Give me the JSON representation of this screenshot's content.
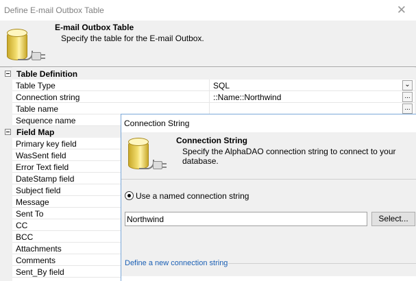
{
  "window": {
    "title": "Define E-mail Outbox Table",
    "close_glyph": "✕"
  },
  "header": {
    "title": "E-mail Outbox Table",
    "subtitle": "Specify the table for the E-mail  Outbox."
  },
  "property_grid": {
    "categories": [
      {
        "label": "Table Definition",
        "rows": [
          {
            "label": "Table Type",
            "value": "SQL"
          },
          {
            "label": "Connection string",
            "value": "::Name::Northwind"
          },
          {
            "label": "Table name",
            "value": ""
          },
          {
            "label": "Sequence name",
            "value": ""
          }
        ]
      },
      {
        "label": "Field Map",
        "rows": [
          {
            "label": "Primary key field"
          },
          {
            "label": "WasSent field"
          },
          {
            "label": "Error Text field"
          },
          {
            "label": "DateStamp field"
          },
          {
            "label": "Subject field"
          },
          {
            "label": "Message"
          },
          {
            "label": "Sent To"
          },
          {
            "label": "CC"
          },
          {
            "label": "BCC"
          },
          {
            "label": "Attachments"
          },
          {
            "label": "Comments"
          },
          {
            "label": "Sent_By field"
          }
        ]
      }
    ],
    "ellipsis_label": "...",
    "dropdown_glyph": "⌄"
  },
  "connection_dialog": {
    "title": "Connection String",
    "header_title": "Connection String",
    "header_subtitle": "Specify the AlphaDAO connection string to connect to your database.",
    "radio_label": "Use a named connection string",
    "connection_value": "Northwind",
    "select_button": "Select...",
    "new_link": "Define a new connection string"
  }
}
